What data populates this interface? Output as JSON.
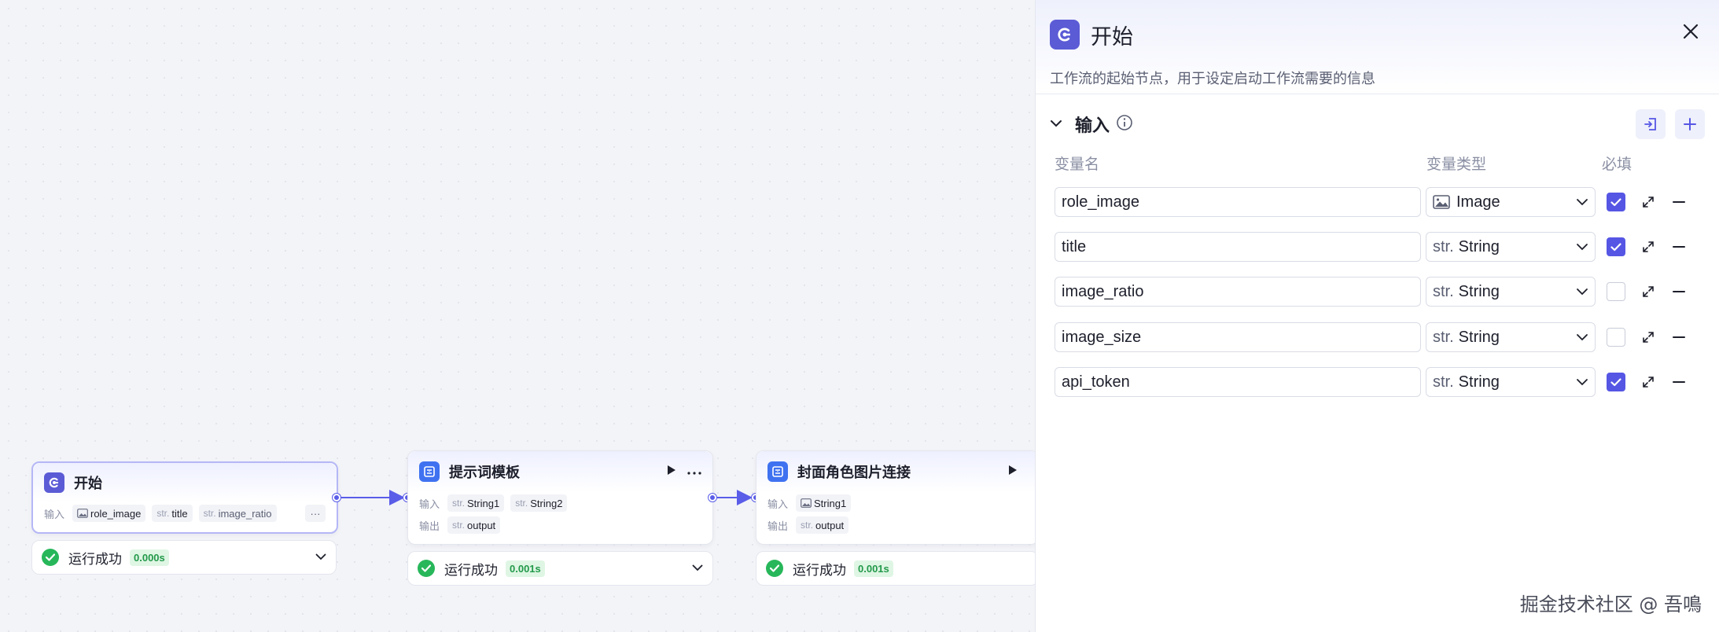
{
  "nodes": {
    "start": {
      "title": "开始",
      "input_label": "输入",
      "inputs": [
        {
          "type": "",
          "name": "role_image"
        },
        {
          "type": "str.",
          "name": "title"
        },
        {
          "type": "str.",
          "name": "image_ratio"
        }
      ],
      "more": "···",
      "status": "运行成功",
      "time": "0.000s"
    },
    "prompt_template": {
      "title": "提示词模板",
      "input_label": "输入",
      "output_label": "输出",
      "inputs": [
        {
          "type": "str.",
          "name": "String1"
        },
        {
          "type": "str.",
          "name": "String2"
        }
      ],
      "outputs": [
        {
          "type": "str.",
          "name": "output"
        }
      ],
      "status": "运行成功",
      "time": "0.001s"
    },
    "cover_link": {
      "title": "封面角色图片连接",
      "input_label": "输入",
      "output_label": "输出",
      "inputs": [
        {
          "type": "",
          "name": "String1"
        }
      ],
      "outputs": [
        {
          "type": "str.",
          "name": "output"
        }
      ],
      "status": "运行成功",
      "time": "0.001s"
    }
  },
  "panel": {
    "title": "开始",
    "description": "工作流的起始节点，用于设定启动工作流需要的信息",
    "section_title": "输入",
    "columns": {
      "name": "变量名",
      "type": "变量类型",
      "required": "必填"
    },
    "variables": [
      {
        "name": "role_image",
        "type_prefix": "",
        "type_label": "Image",
        "type_icon": "image-icon",
        "required": true
      },
      {
        "name": "title",
        "type_prefix": "str.",
        "type_label": "String",
        "type_icon": "",
        "required": true
      },
      {
        "name": "image_ratio",
        "type_prefix": "str.",
        "type_label": "String",
        "type_icon": "",
        "required": false
      },
      {
        "name": "image_size",
        "type_prefix": "str.",
        "type_label": "String",
        "type_icon": "",
        "required": false
      },
      {
        "name": "api_token",
        "type_prefix": "str.",
        "type_label": "String",
        "type_icon": "",
        "required": true
      }
    ]
  },
  "watermark": "掘金技术社区 @ 吾鳴",
  "colors": {
    "accent": "#5656e5",
    "node_icon_purple": "#5b5bd6",
    "node_icon_blue": "#3f72f0",
    "success": "#27b75a",
    "success_badge_bg": "#dff6e4"
  }
}
